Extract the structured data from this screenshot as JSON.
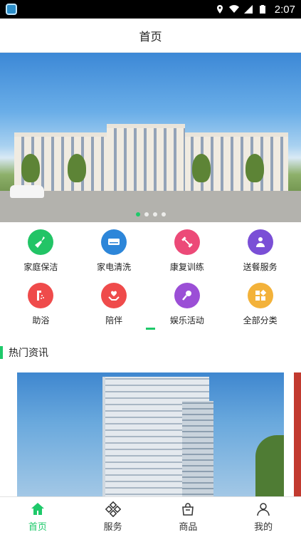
{
  "status_bar": {
    "time": "2:07"
  },
  "header": {
    "title": "首页"
  },
  "banner": {
    "slides": 4,
    "active_index": 0
  },
  "services": [
    {
      "label": "家庭保洁",
      "icon": "broom-icon",
      "color": "#22c466"
    },
    {
      "label": "家电清洗",
      "icon": "air-conditioner-icon",
      "color": "#2d86d9"
    },
    {
      "label": "康复训练",
      "icon": "dumbbell-icon",
      "color": "#ec4a78"
    },
    {
      "label": "送餐服务",
      "icon": "delivery-person-icon",
      "color": "#7a4fd6"
    },
    {
      "label": "助浴",
      "icon": "shower-icon",
      "color": "#ef4b4b"
    },
    {
      "label": "陪伴",
      "icon": "care-hands-icon",
      "color": "#ef4b4b"
    },
    {
      "label": "娱乐活动",
      "icon": "microphone-icon",
      "color": "#9b4fd6"
    },
    {
      "label": "全部分类",
      "icon": "category-icon",
      "color": "#f3b23a"
    }
  ],
  "hot_news": {
    "title": "热门资讯"
  },
  "tabs": [
    {
      "label": "首页",
      "icon": "home-icon",
      "active": true
    },
    {
      "label": "服务",
      "icon": "service-icon",
      "active": false
    },
    {
      "label": "商品",
      "icon": "shopping-bag-icon",
      "active": false
    },
    {
      "label": "我的",
      "icon": "profile-icon",
      "active": false
    }
  ],
  "colors": {
    "accent": "#1ec96a"
  }
}
